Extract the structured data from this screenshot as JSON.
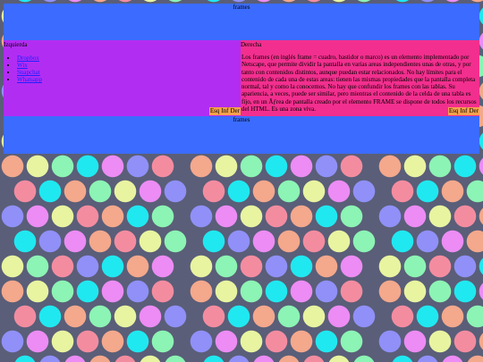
{
  "top_frame": {
    "label": "frames"
  },
  "bottom_frame": {
    "label": "frames"
  },
  "left_pane": {
    "title": "Izquierda",
    "links": [
      "Dropbox",
      "Wix",
      "Snapchat",
      "Whatsapp"
    ],
    "buttons": [
      "Esq",
      "Inf",
      "Der"
    ]
  },
  "right_pane": {
    "title": "Derecha",
    "text": "Los frames (en inglés frame = cuadro, bastidor o marco) es un elemento implementado por Netscape, que permite dividir la pantalla en varias areas independientes unas de otras, y por tanto con contenidos distintos, aunque puedan estar relacionados. No hay límites para el contenido de cada una de estas areas: tienen las mismas propiedades que la pantalla completa normal, tal y como la conocemos. No hay que confundir los frames con las tablas. Su apariencia, a veces, puede ser similar, pero mientras el contenido de la celda de una tabla es fijo, en un Ãƒrea de pantalla creado por el elemento FRAME se dispone de todos los recursos del HTML. Es una zona viva.",
    "buttons": [
      "Esq",
      "Inf",
      "Der"
    ]
  },
  "colors": {
    "frame_bar": "#3b6cff",
    "left_pane": "#b22df2",
    "right_pane": "#f22f8e",
    "button": "#f5a14c",
    "background": "#5a5e78"
  }
}
